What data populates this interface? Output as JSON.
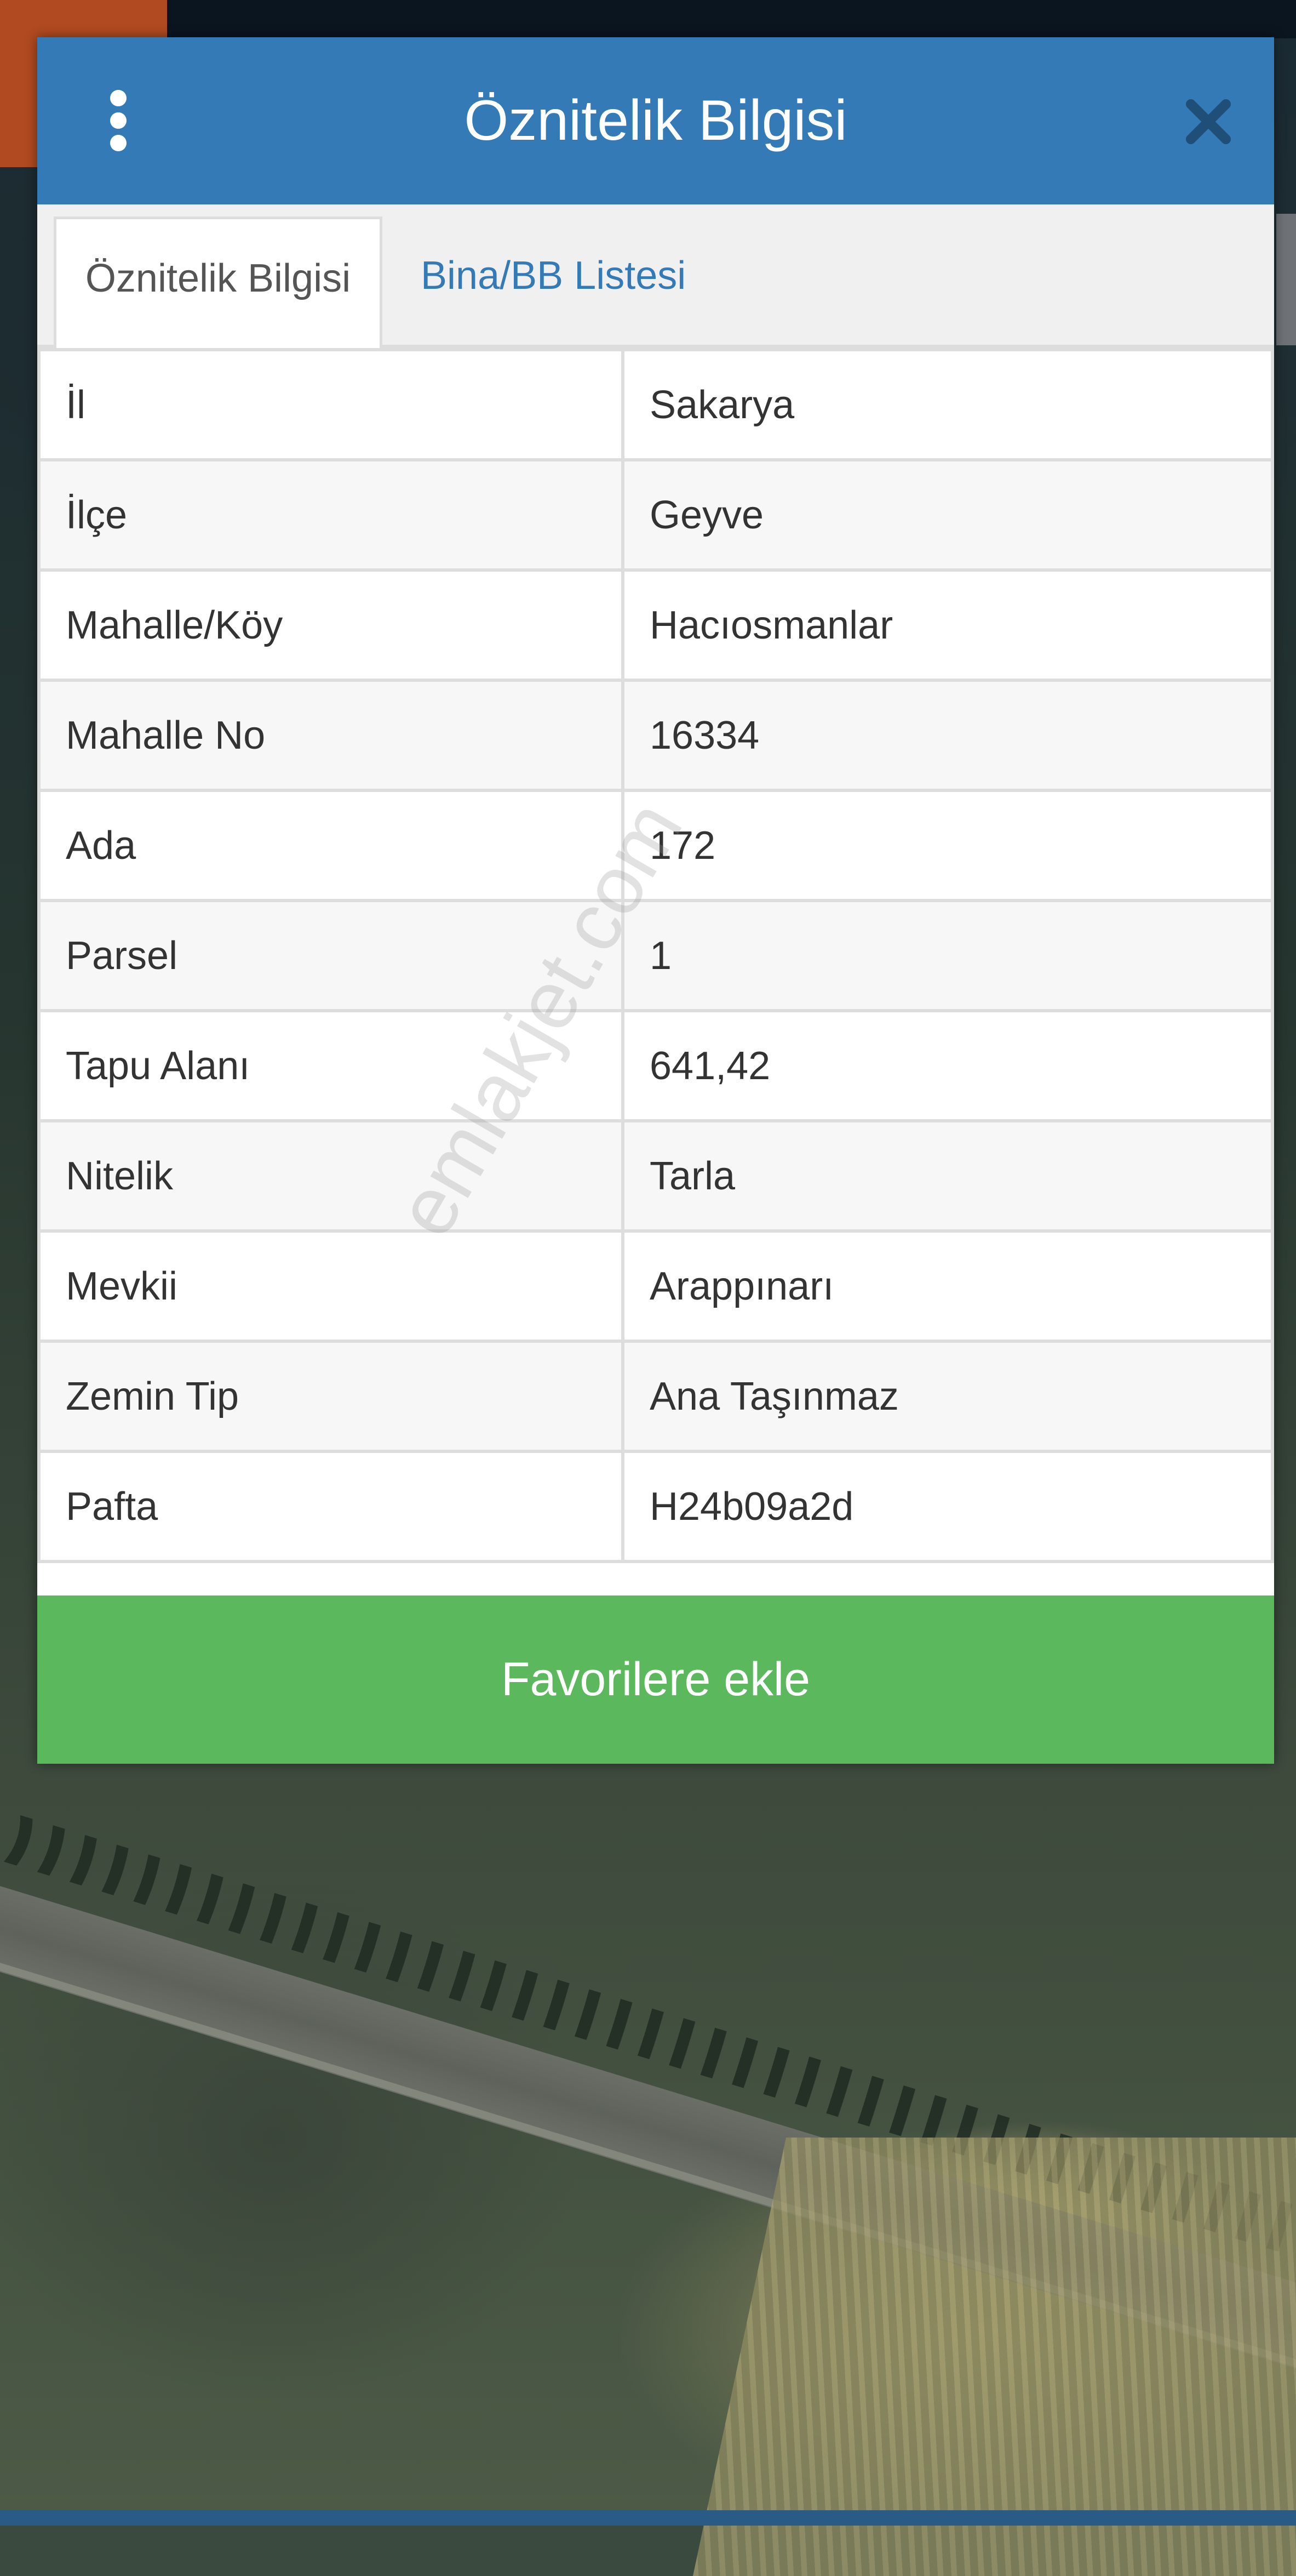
{
  "dialog": {
    "title": "Öznitelik Bilgisi",
    "menu_icon": "vertical-dots-icon",
    "close_icon": "close-icon"
  },
  "tabs": [
    {
      "label": "Öznitelik Bilgisi",
      "active": true
    },
    {
      "label": "Bina/BB Listesi",
      "active": false
    }
  ],
  "attributes": [
    {
      "key": "İl",
      "value": "Sakarya"
    },
    {
      "key": "İlçe",
      "value": "Geyve"
    },
    {
      "key": "Mahalle/Köy",
      "value": "Hacıosmanlar"
    },
    {
      "key": "Mahalle No",
      "value": "16334"
    },
    {
      "key": "Ada",
      "value": "172"
    },
    {
      "key": "Parsel",
      "value": "1"
    },
    {
      "key": "Tapu Alanı",
      "value": "641,42"
    },
    {
      "key": "Nitelik",
      "value": "Tarla"
    },
    {
      "key": "Mevkii",
      "value": "Arappınarı"
    },
    {
      "key": "Zemin Tip",
      "value": "Ana Taşınmaz"
    },
    {
      "key": "Pafta",
      "value": "H24b09a2d"
    }
  ],
  "favorite_button": "Favorilere ekle",
  "watermark": "emlakjet.com",
  "colors": {
    "header": "#337ab7",
    "button": "#5cb85c",
    "tab_link": "#337ab7"
  }
}
